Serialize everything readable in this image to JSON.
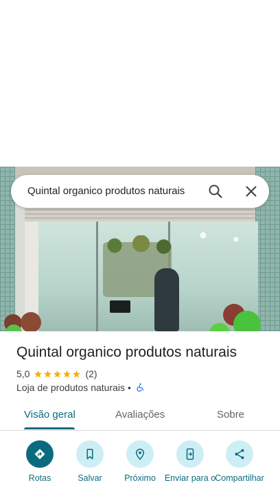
{
  "search": {
    "query": "Quintal organico produtos naturais"
  },
  "place": {
    "name": "Quintal organico produtos naturais",
    "rating": "5,0",
    "stars": 5,
    "review_count": "(2)",
    "category": "Loja de produtos naturais",
    "separator": "•"
  },
  "tabs": [
    {
      "label": "Visão geral",
      "active": true
    },
    {
      "label": "Avaliações",
      "active": false
    },
    {
      "label": "Sobre",
      "active": false
    }
  ],
  "actions": [
    {
      "label": "Rotas",
      "icon": "directions-icon"
    },
    {
      "label": "Salvar",
      "icon": "bookmark-icon"
    },
    {
      "label": "Próximo",
      "icon": "nearby-icon"
    },
    {
      "label": "Enviar para o",
      "icon": "send-to-phone-icon"
    },
    {
      "label": "Compartilhar",
      "icon": "share-icon"
    }
  ],
  "colors": {
    "accent": "#0b6b7e",
    "action_bg": "#cdeef5",
    "star": "#f4b400",
    "accessibility": "#1a73e8"
  }
}
